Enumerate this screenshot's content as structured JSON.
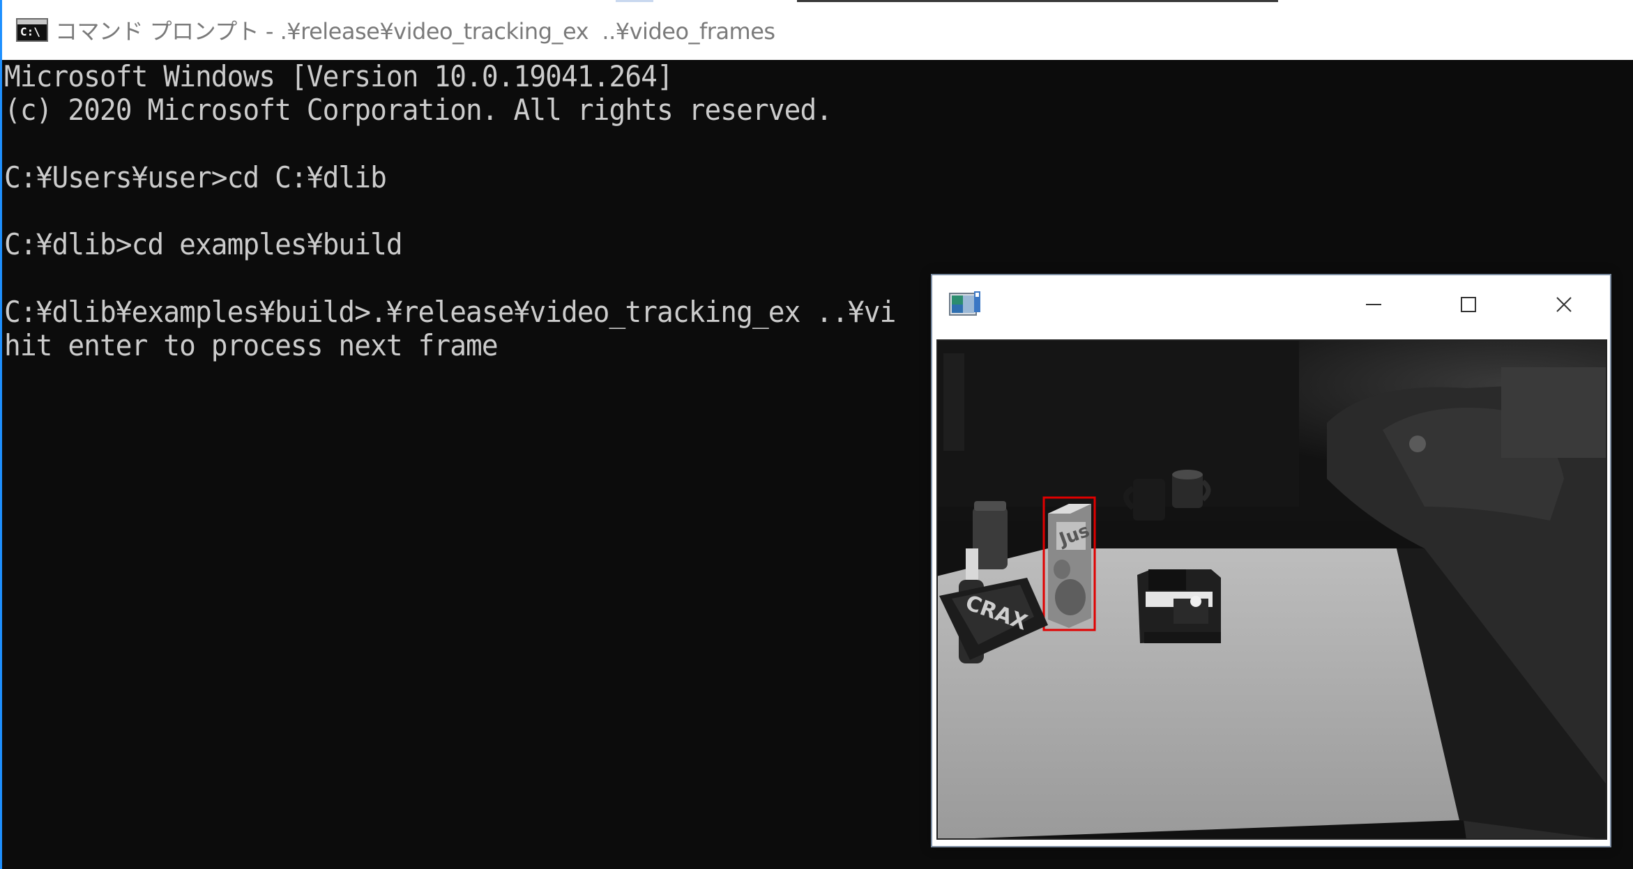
{
  "console": {
    "title": "コマンド プロンプト - .¥release¥video_tracking_ex  ..¥video_frames",
    "icon": "command-prompt-icon",
    "icon_text": "C:\\",
    "lines": [
      "Microsoft Windows [Version 10.0.19041.264]",
      "(c) 2020 Microsoft Corporation. All rights reserved.",
      "",
      "C:¥Users¥user>cd C:¥dlib",
      "",
      "C:¥dlib>cd examples¥build",
      "",
      "C:¥dlib¥examples¥build>.¥release¥video_tracking_ex ..¥vi",
      "hit enter to process next frame"
    ],
    "colors": {
      "background": "#0c0c0c",
      "text": "#cccccc",
      "left_border": "#1e90ff"
    }
  },
  "image_window": {
    "icon": "image-window-icon",
    "controls": [
      "minimize-icon",
      "maximize-icon",
      "close-icon"
    ],
    "content": "grayscale video frame with tracked object",
    "tracking_box_color": "#e00000"
  }
}
